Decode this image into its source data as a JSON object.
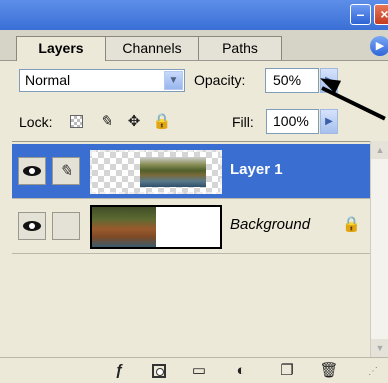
{
  "window": {
    "minimize_icon": "minimize-icon",
    "close_icon": "close-icon"
  },
  "tabs": [
    {
      "label": "Layers",
      "active": true
    },
    {
      "label": "Channels",
      "active": false
    },
    {
      "label": "Paths",
      "active": false
    }
  ],
  "panel_menu_icon": "play-right-icon",
  "blend_mode": {
    "value": "Normal",
    "options_icon": "chevron-down-icon"
  },
  "opacity": {
    "label": "Opacity:",
    "value": "50%"
  },
  "lock": {
    "label": "Lock:",
    "icons": [
      "lock-transparent-pixels-icon",
      "lock-image-pixels-icon",
      "lock-position-icon",
      "lock-all-icon"
    ]
  },
  "fill": {
    "label": "Fill:",
    "value": "100%"
  },
  "layers": [
    {
      "name": "Layer 1",
      "selected": true,
      "visible": true,
      "brush_linked": true,
      "locked": false
    },
    {
      "name": "Background",
      "selected": false,
      "visible": true,
      "brush_linked": false,
      "locked": true
    }
  ],
  "toolbar_icons": [
    "layer-style-icon",
    "layer-mask-icon",
    "new-group-icon",
    "adjustment-layer-icon",
    "new-layer-icon",
    "delete-layer-icon"
  ],
  "colors": {
    "selection": "#3a6fd1",
    "panel_bg": "#ece9d8",
    "titlebar": "#3a6fd6",
    "annotation_arrow": "#000000"
  }
}
